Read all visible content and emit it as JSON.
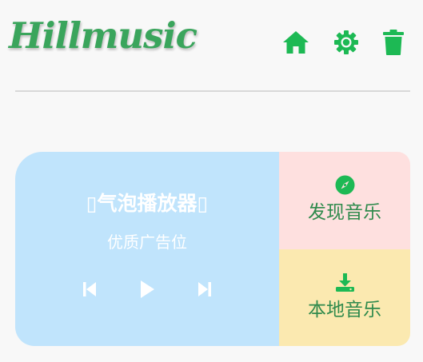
{
  "header": {
    "logo_text": "Hillmusic",
    "icons": {
      "home": "home-icon",
      "settings": "gear-icon",
      "delete": "trash-icon"
    }
  },
  "player": {
    "title": "▯气泡播放器▯",
    "subtitle": "优质广告位",
    "controls": [
      "skip-previous-icon",
      "play-icon",
      "skip-next-icon"
    ]
  },
  "tiles": [
    {
      "label": "发现音乐",
      "icon": "compass-icon"
    },
    {
      "label": "本地音乐",
      "icon": "download-icon"
    }
  ],
  "colors": {
    "accent_green": "#1db954",
    "logo_green": "#3aa55c",
    "player_bg": "#c0e4fc",
    "discover_bg": "#fee0df",
    "local_bg": "#fbe9b0",
    "tile_text": "#2f8a4c"
  }
}
